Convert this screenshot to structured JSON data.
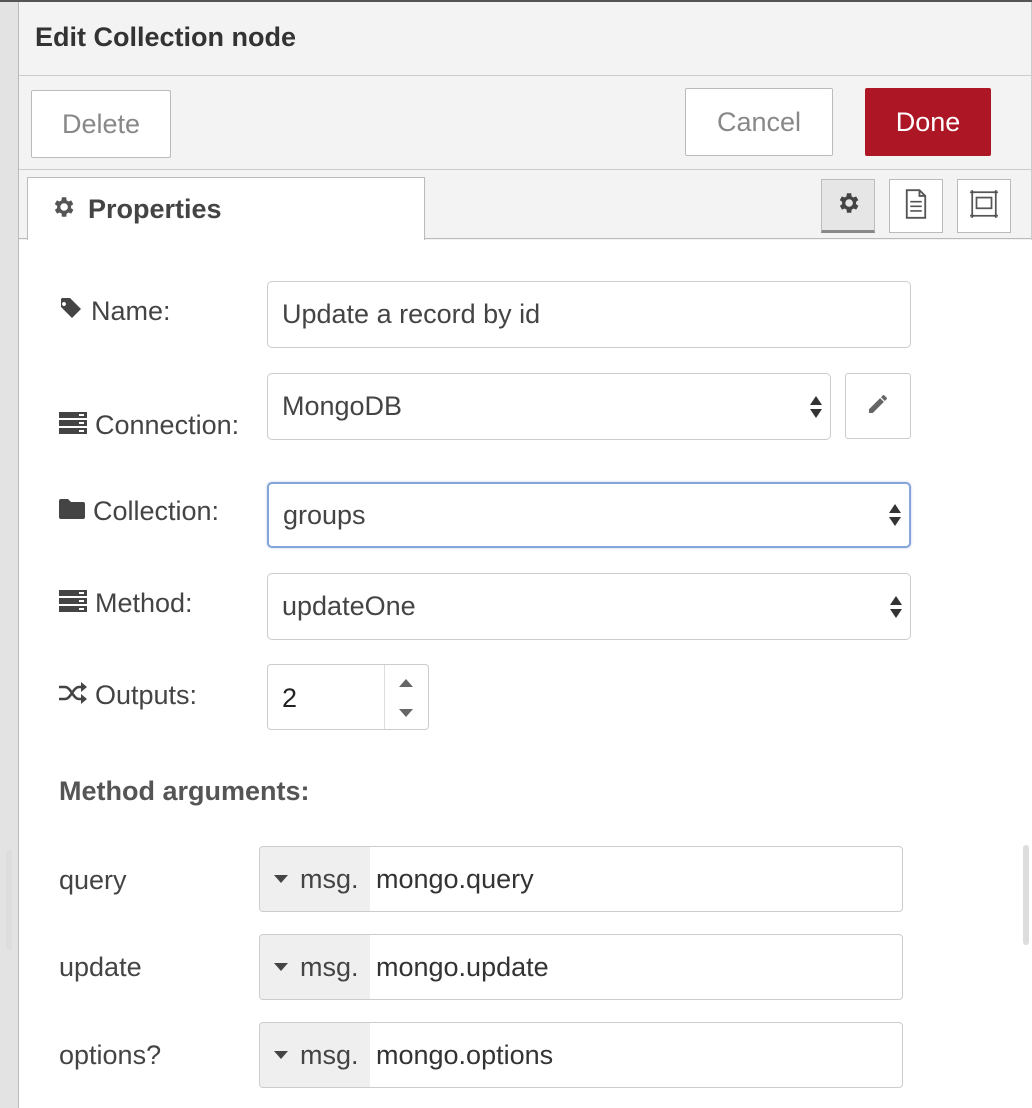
{
  "tray": {
    "title": "Edit Collection node"
  },
  "toolbar": {
    "delete_label": "Delete",
    "cancel_label": "Cancel",
    "done_label": "Done",
    "done_color": "#ad1625"
  },
  "tabs": {
    "properties_label": "Properties"
  },
  "form": {
    "name_label": "Name:",
    "name_value": "Update a record by id",
    "connection_label": "Connection:",
    "connection_value": "MongoDB",
    "collection_label": "Collection:",
    "collection_value": "groups",
    "method_label": "Method:",
    "method_value": "updateOne",
    "outputs_label": "Outputs:",
    "outputs_value": "2"
  },
  "method_args": {
    "title": "Method arguments:",
    "args": [
      {
        "label": "query",
        "type": "msg.",
        "value": "mongo.query"
      },
      {
        "label": "update",
        "type": "msg.",
        "value": "mongo.update"
      },
      {
        "label": "options?",
        "type": "msg.",
        "value": "mongo.options"
      }
    ]
  },
  "icons": {
    "properties_tab": "gear-icon",
    "tab_buttons": [
      "gear-icon",
      "document-icon",
      "appearance-icon"
    ],
    "name": "tag-icon",
    "connection": "server-icon",
    "collection": "folder-icon",
    "method": "server-icon",
    "outputs": "random-icon",
    "edit": "pencil-icon"
  }
}
